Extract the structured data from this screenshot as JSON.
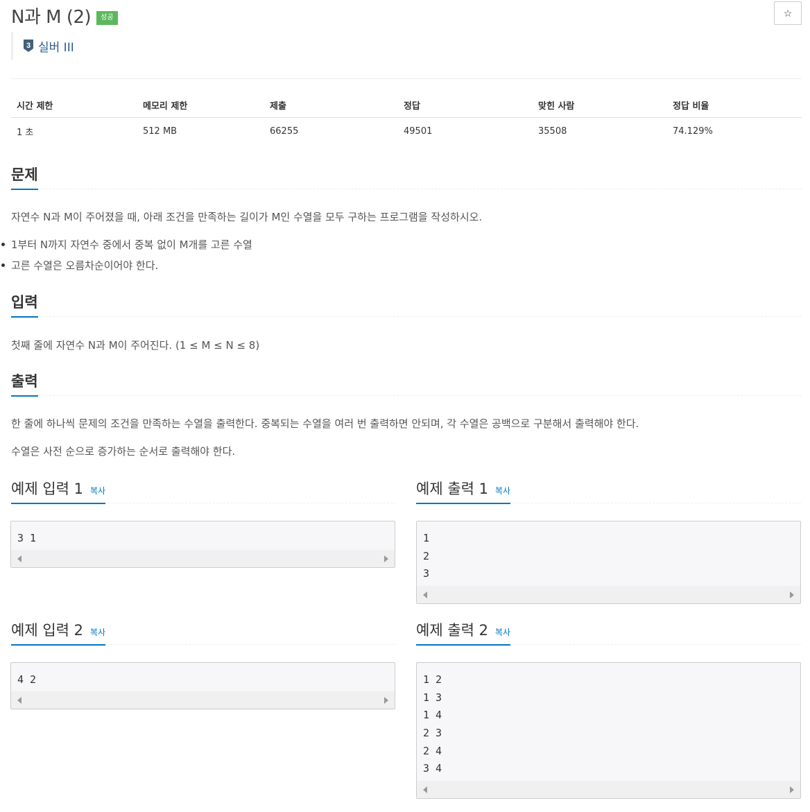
{
  "header": {
    "title": "N과 M (2)",
    "status_badge": "성공",
    "star_icon": "☆"
  },
  "tier": {
    "icon": "silver-tier-3-icon",
    "number": "3",
    "label": "실버 III",
    "color": "#435f7a"
  },
  "info_table": {
    "headers": [
      "시간 제한",
      "메모리 제한",
      "제출",
      "정답",
      "맞힌 사람",
      "정답 비율"
    ],
    "values": [
      "1 초",
      "512 MB",
      "66255",
      "49501",
      "35508",
      "74.129%"
    ]
  },
  "sections": {
    "problem": {
      "title": "문제",
      "text": "자연수 N과 M이 주어졌을 때, 아래 조건을 만족하는 길이가 M인 수열을 모두 구하는 프로그램을 작성하시오.",
      "bullets": [
        "1부터 N까지 자연수 중에서 중복 없이 M개를 고른 수열",
        "고른 수열은 오름차순이어야 한다."
      ]
    },
    "input": {
      "title": "입력",
      "text": "첫째 줄에 자연수 N과 M이 주어진다. (1 ≤ M ≤ N ≤ 8)"
    },
    "output": {
      "title": "출력",
      "text1": "한 줄에 하나씩 문제의 조건을 만족하는 수열을 출력한다. 중복되는 수열을 여러 번 출력하면 안되며, 각 수열은 공백으로 구분해서 출력해야 한다.",
      "text2": "수열은 사전 순으로 증가하는 순서로 출력해야 한다."
    }
  },
  "samples": {
    "copy_label": "복사",
    "input1": {
      "title": "예제 입력 1",
      "lines": [
        "3 1"
      ]
    },
    "output1": {
      "title": "예제 출력 1",
      "lines": [
        "1",
        "2",
        "3"
      ]
    },
    "input2": {
      "title": "예제 입력 2",
      "lines": [
        "4 2"
      ]
    },
    "output2": {
      "title": "예제 출력 2",
      "lines": [
        "1 2",
        "1 3",
        "1 4",
        "2 3",
        "2 4",
        "3 4"
      ]
    }
  }
}
